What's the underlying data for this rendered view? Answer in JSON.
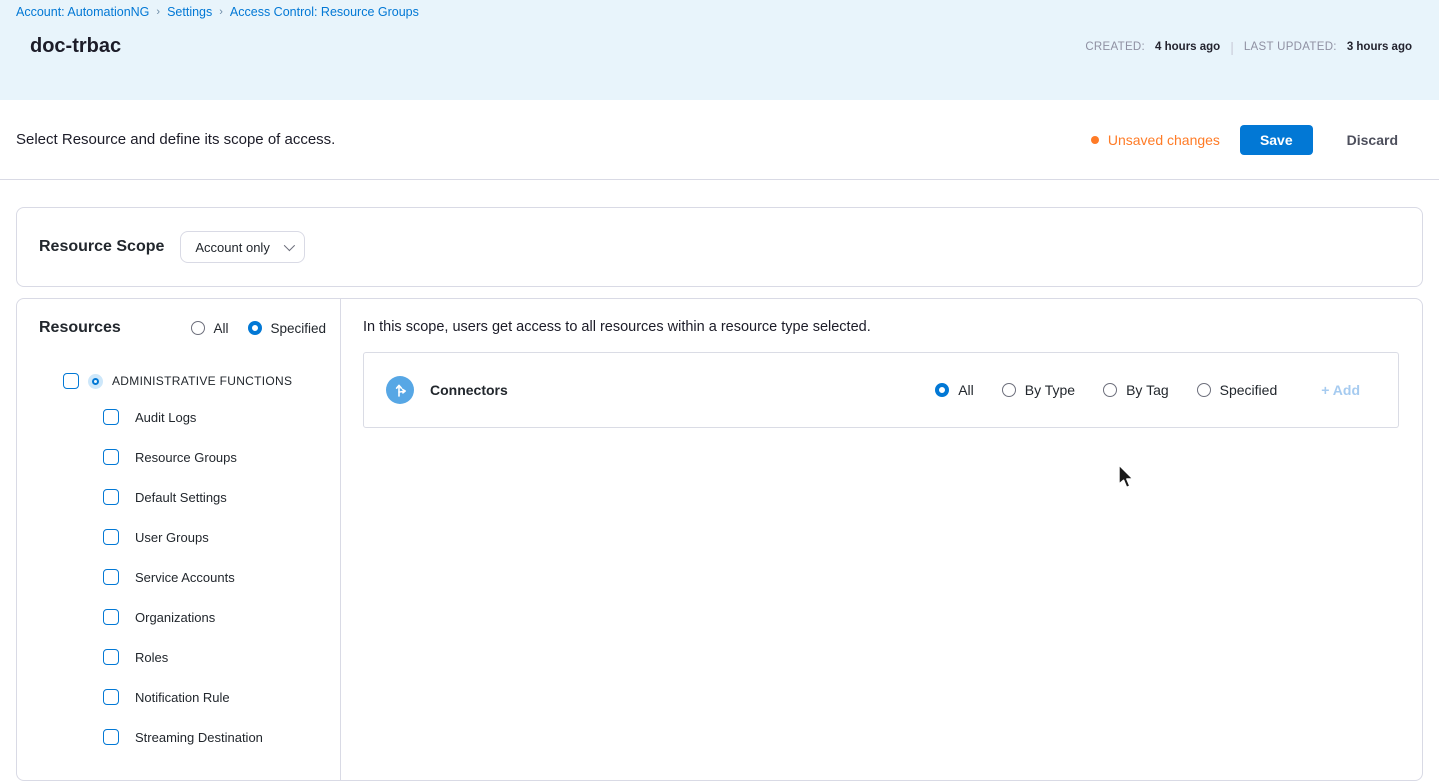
{
  "breadcrumb": {
    "items": [
      "Account: AutomationNG",
      "Settings",
      "Access Control: Resource Groups"
    ],
    "separator": "›"
  },
  "header": {
    "title": "doc-trbac",
    "created_label": "CREATED:",
    "created_value": "4 hours ago",
    "updated_label": "LAST UPDATED:",
    "updated_value": "3 hours ago"
  },
  "toolbar": {
    "description": "Select Resource and define its scope of access.",
    "unsaved_label": "Unsaved changes",
    "save_label": "Save",
    "discard_label": "Discard"
  },
  "resource_scope": {
    "label": "Resource Scope",
    "selected_value": "Account only"
  },
  "resources_panel": {
    "heading": "Resources",
    "scope_options": [
      {
        "label": "All",
        "selected": false
      },
      {
        "label": "Specified",
        "selected": true
      }
    ],
    "group": {
      "label": "ADMINISTRATIVE FUNCTIONS",
      "checked": false
    },
    "items": [
      "Audit Logs",
      "Resource Groups",
      "Default Settings",
      "User Groups",
      "Service Accounts",
      "Organizations",
      "Roles",
      "Notification Rule",
      "Streaming Destination"
    ]
  },
  "main": {
    "description": "In this scope, users get access to all resources within a resource type selected.",
    "resource_row": {
      "name": "Connectors",
      "icon": "connectors-icon",
      "options": [
        {
          "label": "All",
          "selected": true
        },
        {
          "label": "By Type",
          "selected": false
        },
        {
          "label": "By Tag",
          "selected": false
        },
        {
          "label": "Specified",
          "selected": false
        }
      ],
      "add_label": "+ Add"
    }
  },
  "colors": {
    "accent": "#0278d5",
    "warning": "#ff7b26",
    "header_band": "#e8f4fb",
    "border": "#d9dae5",
    "connectors_icon_bg": "#57a7e5"
  }
}
